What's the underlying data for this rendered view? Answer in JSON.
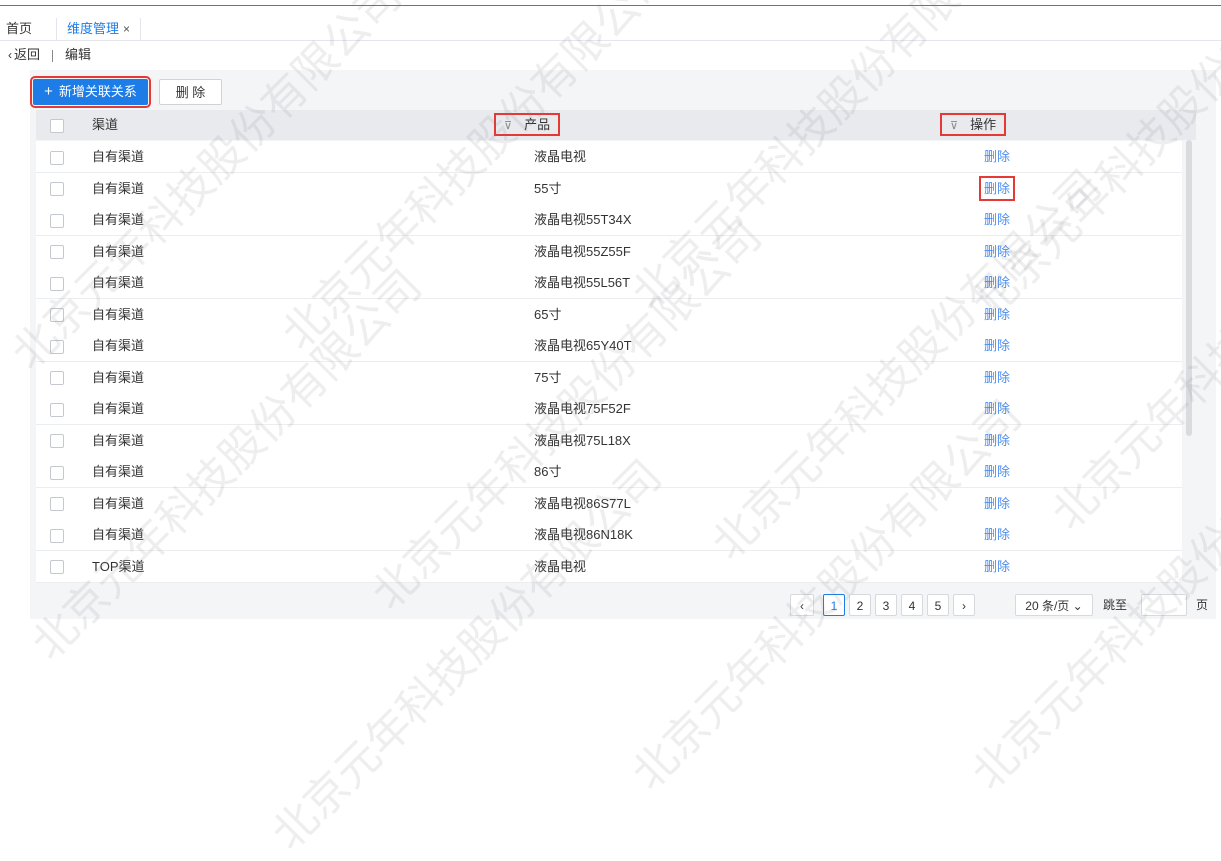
{
  "tabs": {
    "home": "首页",
    "active": "维度管理",
    "close": "×"
  },
  "breadcrumb": {
    "back_icon": "‹",
    "back": "返回",
    "current": "编辑"
  },
  "toolbar": {
    "add_label": "新增关联关系",
    "plus": "+",
    "delete_label": "删 除"
  },
  "table": {
    "headers": {
      "channel": "渠道",
      "product": "产品",
      "action": "操作",
      "filter_icon": "⊽"
    },
    "rows": [
      {
        "channel": "自有渠道",
        "product": "液晶电视",
        "action": "删除"
      },
      {
        "channel": "自有渠道",
        "product": "55寸",
        "action": "删除"
      },
      {
        "channel": "自有渠道",
        "product": "液晶电视55T34X",
        "action": "删除"
      },
      {
        "channel": "自有渠道",
        "product": "液晶电视55Z55F",
        "action": "删除"
      },
      {
        "channel": "自有渠道",
        "product": "液晶电视55L56T",
        "action": "删除"
      },
      {
        "channel": "自有渠道",
        "product": "65寸",
        "action": "删除"
      },
      {
        "channel": "自有渠道",
        "product": "液晶电视65Y40T",
        "action": "删除"
      },
      {
        "channel": "自有渠道",
        "product": "75寸",
        "action": "删除"
      },
      {
        "channel": "自有渠道",
        "product": "液晶电视75F52F",
        "action": "删除"
      },
      {
        "channel": "自有渠道",
        "product": "液晶电视75L18X",
        "action": "删除"
      },
      {
        "channel": "自有渠道",
        "product": "86寸",
        "action": "删除"
      },
      {
        "channel": "自有渠道",
        "product": "液晶电视86S77L",
        "action": "删除"
      },
      {
        "channel": "自有渠道",
        "product": "液晶电视86N18K",
        "action": "删除"
      },
      {
        "channel": "TOP渠道",
        "product": "液晶电视",
        "action": "删除"
      }
    ]
  },
  "pagination": {
    "prev": "‹",
    "next": "›",
    "pages": [
      "1",
      "2",
      "3",
      "4",
      "5"
    ],
    "current_page": "1",
    "page_size": "20 条/页",
    "page_size_icon": "⌄",
    "jump_label": "跳至",
    "page_unit": "页"
  },
  "watermark": "北京元年科技股份有限公司",
  "colors": {
    "primary": "#1e7ce6",
    "highlight": "#e53935",
    "link": "#4a8ef0"
  }
}
